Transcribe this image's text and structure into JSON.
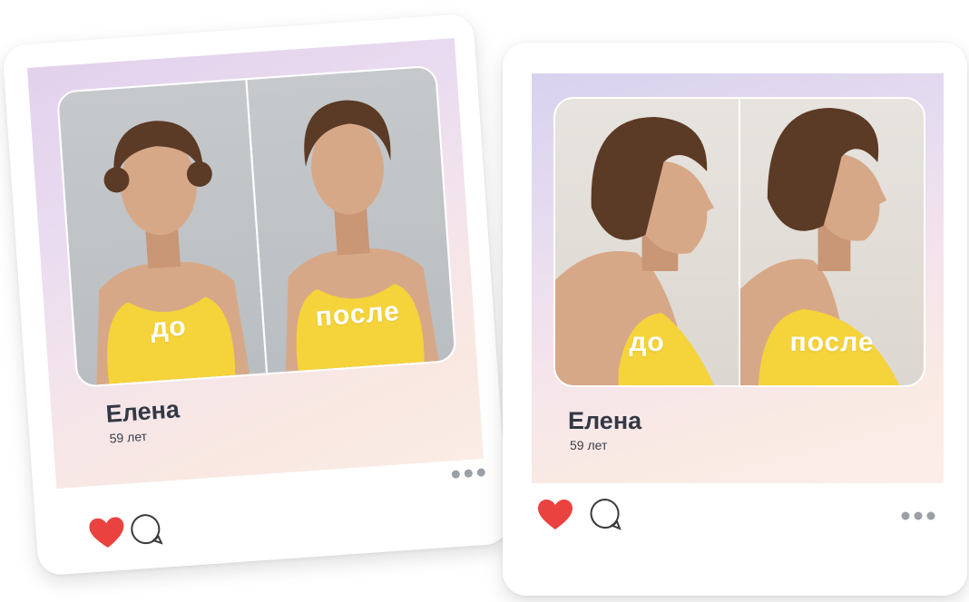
{
  "cards": [
    {
      "before_label": "до",
      "after_label": "после",
      "name": "Елена",
      "age": "59 лет",
      "view": "front",
      "icons": [
        "heart-icon",
        "comment-icon",
        "more-icon"
      ]
    },
    {
      "before_label": "до",
      "after_label": "после",
      "name": "Елена",
      "age": "59 лет",
      "view": "profile",
      "icons": [
        "heart-icon",
        "comment-icon",
        "more-icon"
      ]
    }
  ],
  "colors": {
    "heart": "#e9423f",
    "top": "#f5d33a",
    "hair": "#5b3a26",
    "skin": "#d7a887",
    "text": "#333844"
  }
}
